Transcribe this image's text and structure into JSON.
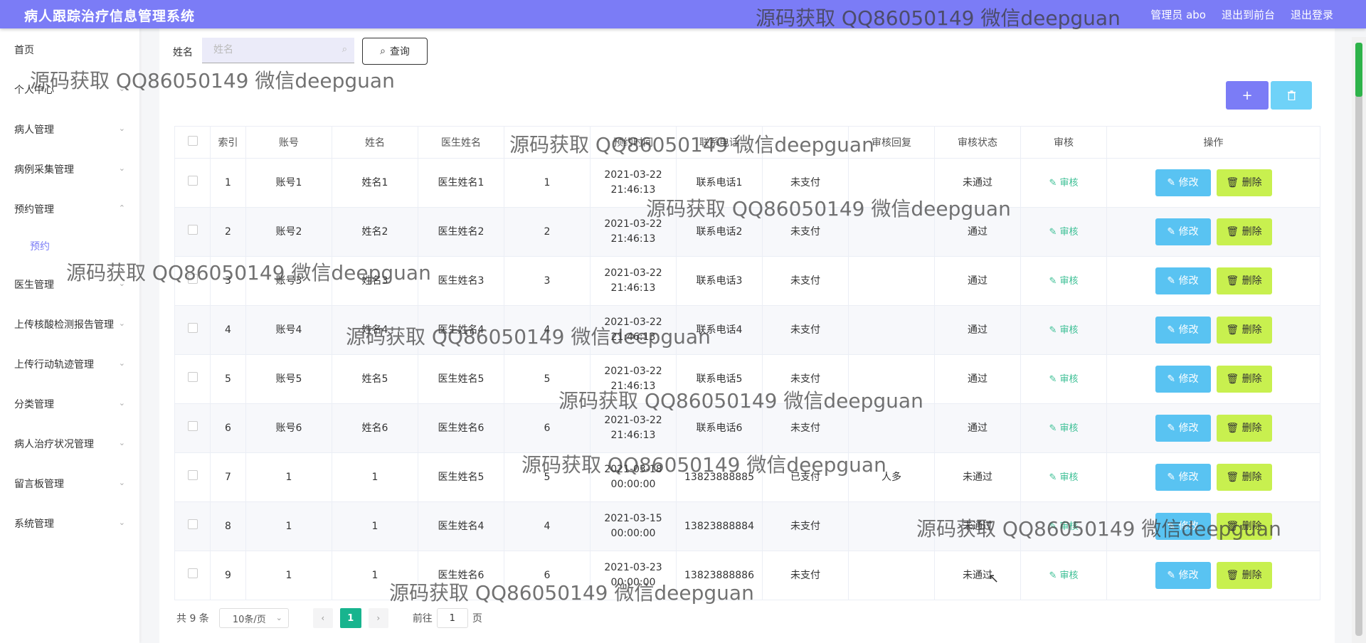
{
  "header": {
    "title": "病人跟踪治疗信息管理系统",
    "links": [
      "管理员 abo",
      "退出到前台",
      "退出登录"
    ]
  },
  "watermark_text": "源码获取 QQ86050149 微信deepguan",
  "sidebar": {
    "items": [
      {
        "label": "首页",
        "expandable": false
      },
      {
        "label": "个人中心",
        "expandable": true
      },
      {
        "label": "病人管理",
        "expandable": true
      },
      {
        "label": "病例采集管理",
        "expandable": true
      },
      {
        "label": "预约管理",
        "expandable": true,
        "expanded": true
      },
      {
        "label": "医生管理",
        "expandable": true
      },
      {
        "label": "上传核酸检测报告管理",
        "expandable": true
      },
      {
        "label": "上传行动轨迹管理",
        "expandable": true
      },
      {
        "label": "分类管理",
        "expandable": true
      },
      {
        "label": "病人治疗状况管理",
        "expandable": true
      },
      {
        "label": "留言板管理",
        "expandable": true
      },
      {
        "label": "系统管理",
        "expandable": true
      }
    ],
    "sub_item": "预约"
  },
  "search": {
    "label": "姓名",
    "placeholder": "姓名",
    "query_label": "查询"
  },
  "toolbar": {
    "add_label": "+",
    "delete_icon": "trash-icon"
  },
  "table": {
    "headers": [
      "索引",
      "账号",
      "姓名",
      "医生姓名",
      "",
      "预约时间",
      "联系电话",
      "",
      "审核回复",
      "审核状态",
      "审核",
      "操作"
    ],
    "audit_label": "审核",
    "edit_label": "修改",
    "delete_label": "删除",
    "rows": [
      {
        "index": "1",
        "account": "账号1",
        "name": "姓名1",
        "doctor": "医生姓名1",
        "num": "1",
        "time": "2021-03-22 21:46:13",
        "phone": "联系电话1",
        "pay": "未支付",
        "reply": "",
        "status": "未通过"
      },
      {
        "index": "2",
        "account": "账号2",
        "name": "姓名2",
        "doctor": "医生姓名2",
        "num": "2",
        "time": "2021-03-22 21:46:13",
        "phone": "联系电话2",
        "pay": "未支付",
        "reply": "",
        "status": "通过"
      },
      {
        "index": "3",
        "account": "账号3",
        "name": "姓名3",
        "doctor": "医生姓名3",
        "num": "3",
        "time": "2021-03-22 21:46:13",
        "phone": "联系电话3",
        "pay": "未支付",
        "reply": "",
        "status": "通过"
      },
      {
        "index": "4",
        "account": "账号4",
        "name": "姓名4",
        "doctor": "医生姓名4",
        "num": "4",
        "time": "2021-03-22 21:46:13",
        "phone": "联系电话4",
        "pay": "未支付",
        "reply": "",
        "status": "通过"
      },
      {
        "index": "5",
        "account": "账号5",
        "name": "姓名5",
        "doctor": "医生姓名5",
        "num": "5",
        "time": "2021-03-22 21:46:13",
        "phone": "联系电话5",
        "pay": "未支付",
        "reply": "",
        "status": "通过"
      },
      {
        "index": "6",
        "account": "账号6",
        "name": "姓名6",
        "doctor": "医生姓名6",
        "num": "6",
        "time": "2021-03-22 21:46:13",
        "phone": "联系电话6",
        "pay": "未支付",
        "reply": "",
        "status": "通过"
      },
      {
        "index": "7",
        "account": "1",
        "name": "1",
        "doctor": "医生姓名5",
        "num": "5",
        "time": "2021-03-18 00:00:00",
        "phone": "13823888885",
        "pay": "已支付",
        "reply": "人多",
        "status": "未通过"
      },
      {
        "index": "8",
        "account": "1",
        "name": "1",
        "doctor": "医生姓名4",
        "num": "4",
        "time": "2021-03-15 00:00:00",
        "phone": "13823888884",
        "pay": "未支付",
        "reply": "",
        "status": "未通过"
      },
      {
        "index": "9",
        "account": "1",
        "name": "1",
        "doctor": "医生姓名6",
        "num": "6",
        "time": "2021-03-23 00:00:00",
        "phone": "13823888886",
        "pay": "未支付",
        "reply": "",
        "status": "未通过"
      }
    ]
  },
  "pager": {
    "total": "共 9 条",
    "page_size": "10条/页",
    "current_page": "1",
    "goto_prefix": "前往",
    "goto_value": "1",
    "goto_suffix": "页"
  },
  "colors": {
    "header": "#7b7cf6",
    "edit_button": "#59c3f2",
    "delete_button": "#c8f04f",
    "audit_link": "#3bbf94",
    "current_page": "#18b48e"
  }
}
